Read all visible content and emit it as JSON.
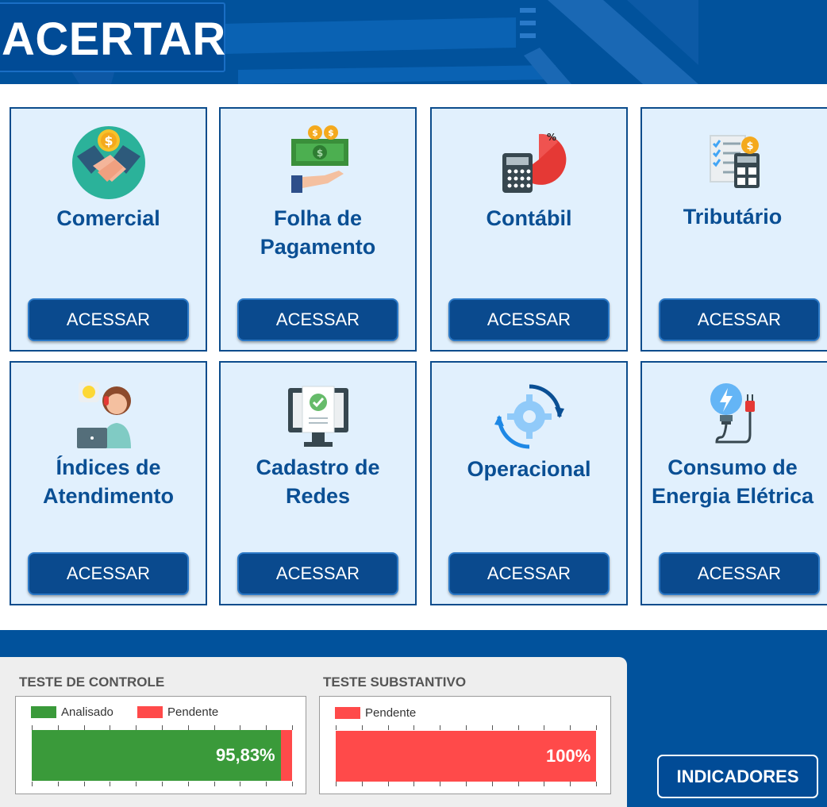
{
  "header": {
    "title": "ACERTAR"
  },
  "cards": [
    {
      "label": "Comercial",
      "button": "ACESSAR",
      "icon": "handshake-coin-icon"
    },
    {
      "label": "Folha de Pagamento",
      "button": "ACESSAR",
      "icon": "money-hand-icon"
    },
    {
      "label": "Contábil",
      "button": "ACESSAR",
      "icon": "calculator-pie-icon"
    },
    {
      "label": "Tributário",
      "button": "ACESSAR",
      "icon": "tax-calculator-icon"
    },
    {
      "label": "Índices de Atendimento",
      "button": "ACESSAR",
      "icon": "support-agent-icon"
    },
    {
      "label": "Cadastro de Redes",
      "button": "ACESSAR",
      "icon": "monitor-check-icon"
    },
    {
      "label": "Operacional",
      "button": "ACESSAR",
      "icon": "gear-cycle-icon"
    },
    {
      "label": "Consumo de Energia Elétrica",
      "button": "ACESSAR",
      "icon": "bulb-plug-icon"
    }
  ],
  "tests": {
    "controle": {
      "title": "TESTE DE CONTROLE",
      "legend": [
        "Analisado",
        "Pendente"
      ],
      "value_label": "95,83%"
    },
    "substantivo": {
      "title": "TESTE SUBSTANTIVO",
      "legend": [
        "Pendente"
      ],
      "value_label": "100%"
    }
  },
  "indicadores_button": "INDICADORES",
  "colors": {
    "brand": "#01529c",
    "analisado": "#3a9a3a",
    "pendente": "#ff4a4a"
  },
  "chart_data": [
    {
      "type": "bar",
      "title": "TESTE DE CONTROLE",
      "series": [
        {
          "name": "Analisado",
          "values": [
            95.83
          ]
        },
        {
          "name": "Pendente",
          "values": [
            4.17
          ]
        }
      ],
      "stacked": true,
      "orientation": "horizontal",
      "legend": "top-left"
    },
    {
      "type": "bar",
      "title": "TESTE SUBSTANTIVO",
      "series": [
        {
          "name": "Pendente",
          "values": [
            100
          ]
        }
      ],
      "stacked": true,
      "orientation": "horizontal",
      "legend": "top-left"
    }
  ]
}
